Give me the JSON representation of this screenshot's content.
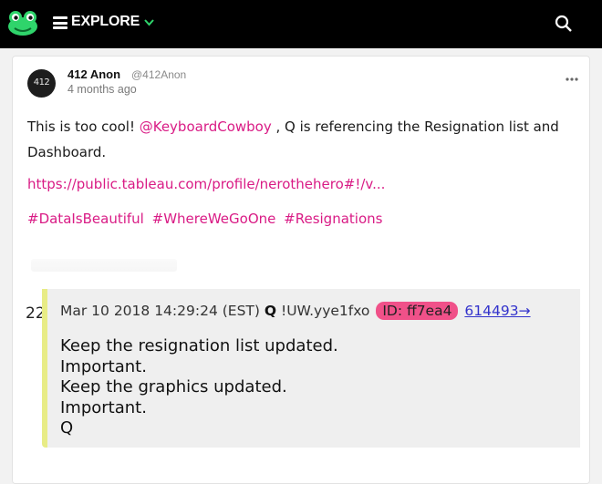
{
  "navbar": {
    "label": "EXPLORE",
    "logo_icon": "frog-logo-icon",
    "menu_icon": "hamburger-menu-icon",
    "dropdown_icon": "chevron-down-icon",
    "search_icon": "search-icon",
    "accent_color": "#2fd46b"
  },
  "post": {
    "avatar_text": "412",
    "author_name": "412 Anon",
    "author_handle": "@412Anon",
    "time": "4 months ago",
    "more_icon": "ellipsis-icon",
    "text_before": "This is too cool! ",
    "mention": "@KeyboardCowboy",
    "text_after": " , Q is referencing the Resignation list and Dashboard.",
    "link": "https://public.tableau.com/profile/nerothehero#!/v...",
    "hashtags": [
      "#DataIsBeautiful",
      "#WhereWeGoOne",
      "#Resignations"
    ],
    "link_color": "#d91b85"
  },
  "embed": {
    "left_number": "22",
    "date": "Mar 10 2018 14:29:24 (EST)",
    "poster": "Q",
    "tripcode": "!UW.yye1fxo",
    "id_badge": "ID: ff7ea4",
    "post_ref": "614493→",
    "lines": [
      "Keep the resignation list updated.",
      "Important.",
      "Keep the graphics updated.",
      "Important.",
      "Q"
    ]
  }
}
